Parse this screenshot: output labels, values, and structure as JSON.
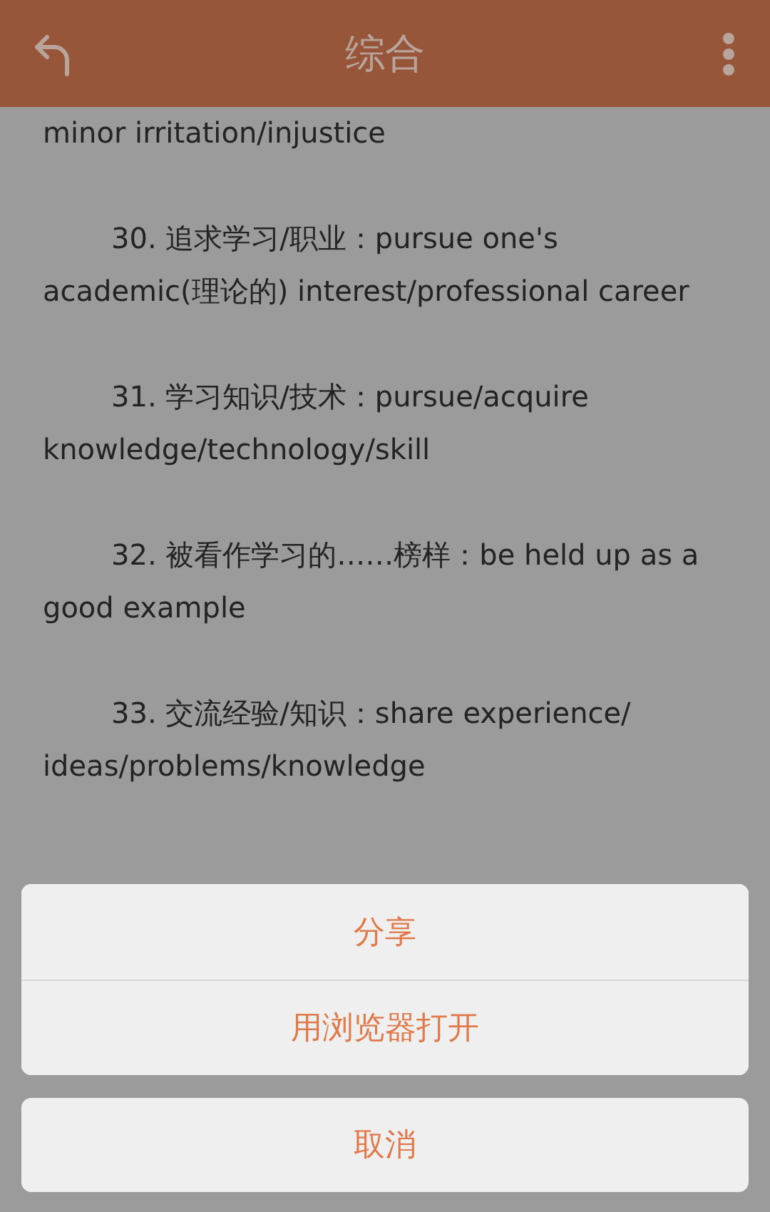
{
  "app_bar": {
    "title": "综合"
  },
  "paragraphs": [
    {
      "kind": "continuation",
      "text": "minor irritation/injustice"
    },
    {
      "kind": "item",
      "text": "30. 追求学习/职业：pursue one's academic(理论的) interest/professional career"
    },
    {
      "kind": "item",
      "text": "31. 学习知识/技术：pursue/acquire knowledge/technology/skill"
    },
    {
      "kind": "item",
      "text": "32. 被看作学习的……榜样：be held up as a good example"
    },
    {
      "kind": "item",
      "text": "33. 交流经验/知识：share experience/ ideas/problems/knowledge"
    }
  ],
  "action_sheet": {
    "actions": [
      "分享",
      "用浏览器打开"
    ],
    "cancel": "取消"
  }
}
